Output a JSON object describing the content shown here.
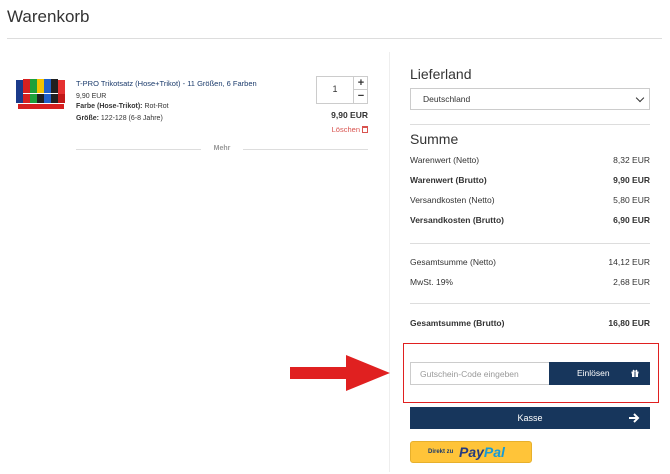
{
  "page": {
    "title": "Warenkorb"
  },
  "cart": {
    "items": [
      {
        "name": "T-PRO Trikotsatz (Hose+Trikot) - 11 Größen, 6 Farben",
        "unit_price": "9,90 EUR",
        "attr1_label": "Farbe (Hose-Trikot):",
        "attr1_value": "Rot-Rot",
        "attr2_label": "Größe:",
        "attr2_value": "122-128 (6-8 Jahre)",
        "quantity": "1",
        "total": "9,90 EUR",
        "delete_label": "Löschen"
      }
    ],
    "more_label": "Mehr",
    "qty_plus": "+",
    "qty_minus": "−"
  },
  "shipping": {
    "heading": "Lieferland",
    "country": "Deutschland"
  },
  "summary": {
    "heading": "Summe",
    "rows": [
      {
        "label": "Warenwert (Netto)",
        "value": "8,32 EUR"
      },
      {
        "label": "Warenwert (Brutto)",
        "value": "9,90 EUR"
      },
      {
        "label": "Versandkosten (Netto)",
        "value": "5,80 EUR"
      },
      {
        "label": "Versandkosten (Brutto)",
        "value": "6,90 EUR"
      },
      {
        "label": "Gesamtsumme (Netto)",
        "value": "14,12 EUR"
      },
      {
        "label": "MwSt. 19%",
        "value": "2,68 EUR"
      },
      {
        "label": "Gesamtsumme (Brutto)",
        "value": "16,80 EUR"
      }
    ]
  },
  "coupon": {
    "placeholder": "Gutschein-Code eingeben",
    "redeem_label": "Einlösen",
    "icon": "gift-icon"
  },
  "checkout": {
    "label": "Kasse",
    "icon": "arrow-right-icon"
  },
  "paypal": {
    "small_label": "Direkt zu",
    "logo_pay": "Pay",
    "logo_pal": "Pal"
  },
  "colors": {
    "primary": "#17365c",
    "highlight": "#e02020",
    "paypal_yellow": "#ffc439",
    "delete": "#d9534f"
  }
}
